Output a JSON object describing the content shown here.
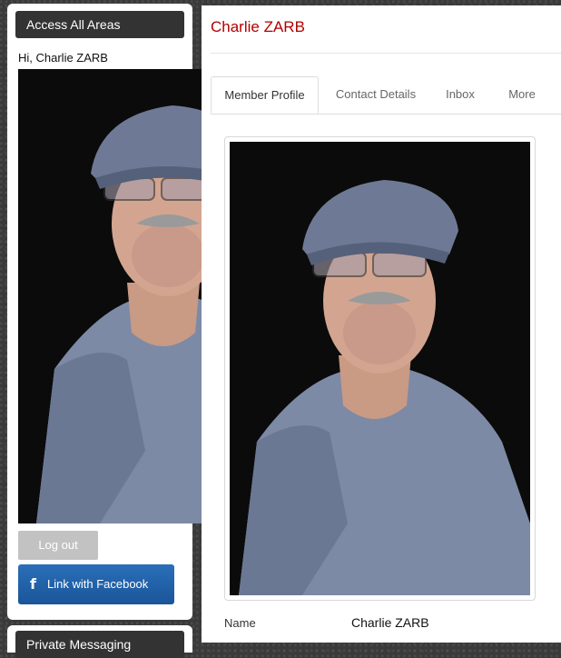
{
  "sidebar": {
    "header": "Access All Areas",
    "greeting": "Hi, Charlie ZARB",
    "logout_label": "Log out",
    "facebook_label": "Link with Facebook",
    "facebook_icon": "facebook-icon",
    "next_header": "Private Messaging"
  },
  "main": {
    "member_name": "Charlie ZARB",
    "tabs": [
      {
        "label": "Member Profile",
        "active": true
      },
      {
        "label": "Contact Details",
        "active": false
      },
      {
        "label": "Inbox",
        "active": false
      },
      {
        "label": "More",
        "active": false
      }
    ],
    "fields": [
      {
        "label": "Name",
        "value": "Charlie ZARB"
      }
    ]
  },
  "colors": {
    "accent_red": "#b30000",
    "facebook_blue": "#1a559a",
    "header_dark": "#333333"
  }
}
